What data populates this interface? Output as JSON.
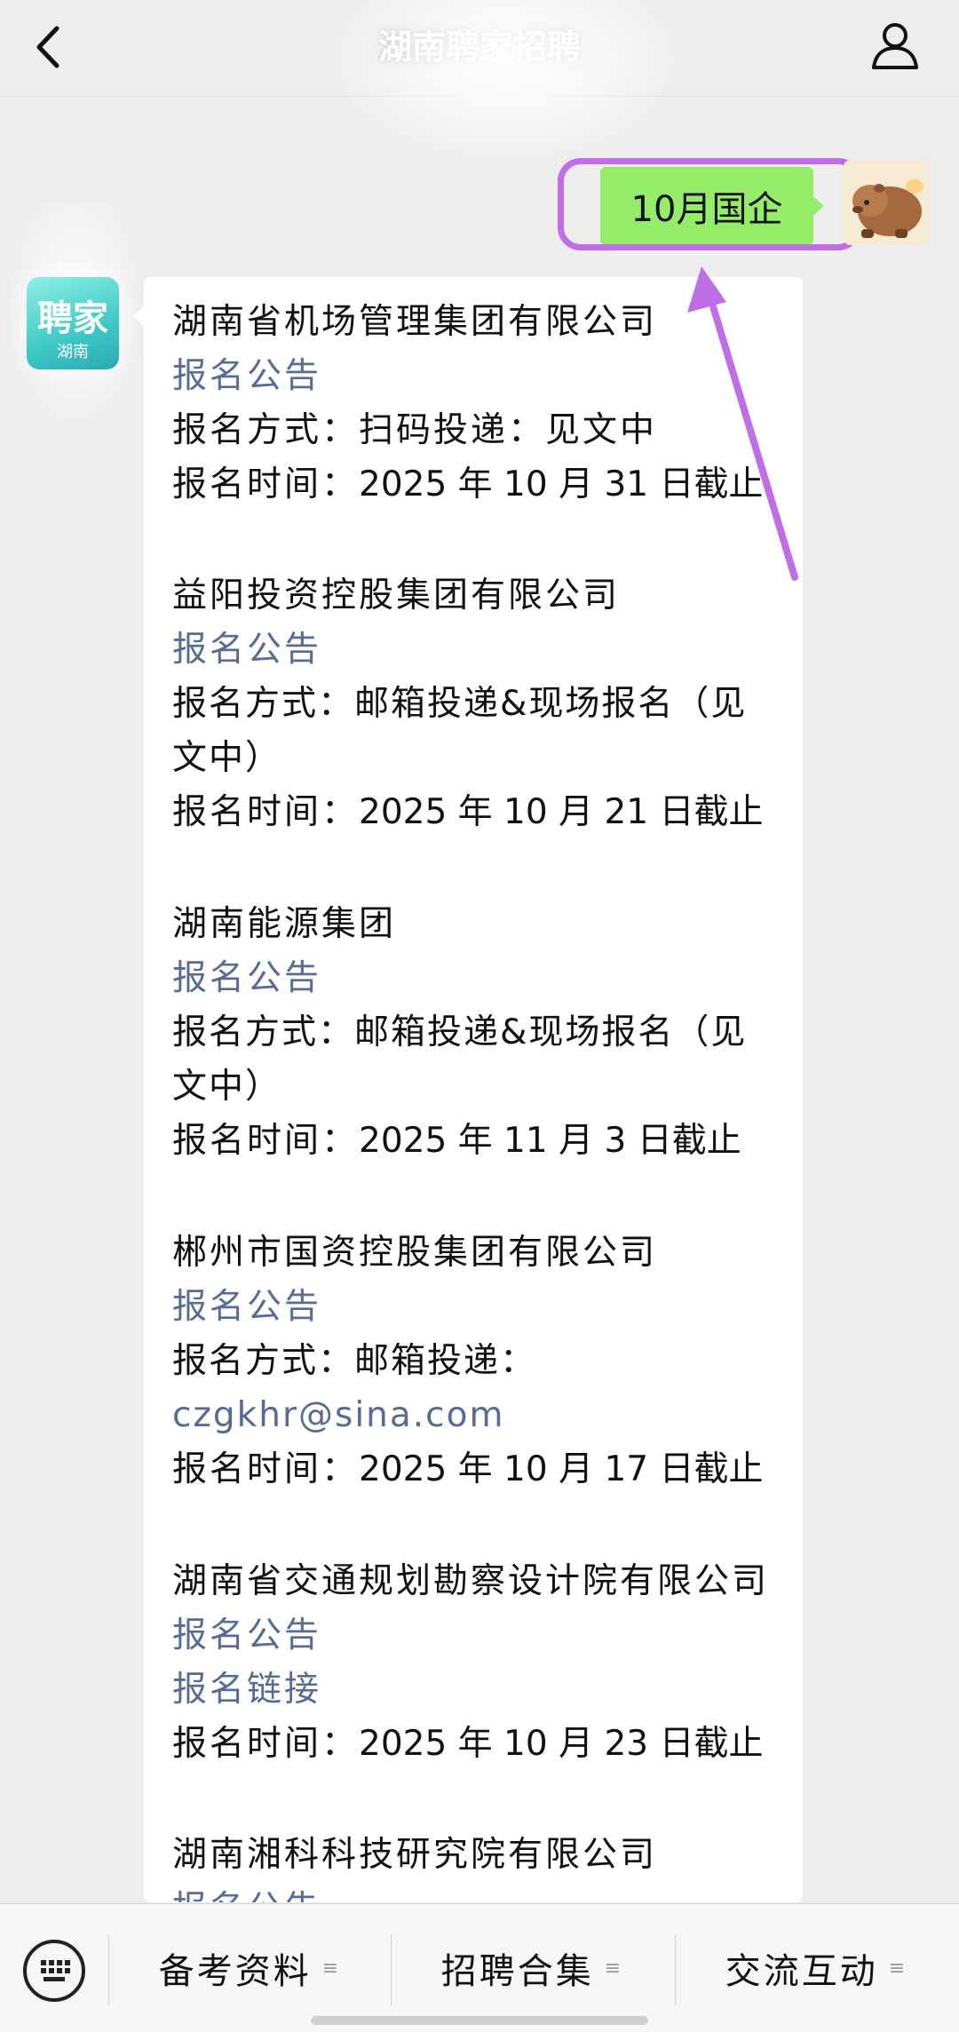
{
  "header": {
    "title": "湖南聘家招聘"
  },
  "sent_message": {
    "text": "10月国企"
  },
  "official_account": {
    "avatar_text": "聘家",
    "avatar_sub": "湖南"
  },
  "entries": [
    {
      "company": "湖南省机场管理集团有限公司",
      "notice_link": "报名公告",
      "method_label": "报名方式：",
      "method_value": "扫码投递：见文中",
      "time_label": "报名时间：",
      "time_value": "2025 年 10 月 31 日截止"
    },
    {
      "company": "益阳投资控股集团有限公司",
      "notice_link": "报名公告",
      "method_label": "报名方式：",
      "method_value": "邮箱投递&现场报名（见文中）",
      "time_label": "报名时间：",
      "time_value": "2025 年 10 月 21 日截止"
    },
    {
      "company": "湖南能源集团",
      "notice_link": "报名公告",
      "method_label": "报名方式：",
      "method_value": "邮箱投递&现场报名（见文中）",
      "time_label": "报名时间：",
      "time_value": "2025 年 11 月 3 日截止"
    },
    {
      "company": "郴州市国资控股集团有限公司",
      "notice_link": "报名公告",
      "method_label": "报名方式：",
      "method_value": "邮箱投递：",
      "method_email": "czgkhr@sina.com",
      "time_label": "报名时间：",
      "time_value": "2025 年 10 月 17 日截止"
    },
    {
      "company": "湖南省交通规划勘察设计院有限公司",
      "notice_link": "报名公告",
      "apply_link": "报名链接",
      "time_label": "报名时间：",
      "time_value": "2025 年 10 月 23 日截止"
    },
    {
      "company": "湖南湘科科技研究院有限公司",
      "notice_link": "报名公告"
    }
  ],
  "bottom_menu": {
    "items": [
      {
        "label": "备考资料",
        "icon": "menu-lines-icon"
      },
      {
        "label": "招聘合集",
        "icon": "menu-lines-icon"
      },
      {
        "label": "交流互动",
        "icon": "menu-lines-icon"
      }
    ]
  },
  "colors": {
    "sent_bubble": "#95ec69",
    "link": "#576b95",
    "highlight": "#c06ee6",
    "background": "#ededed"
  }
}
